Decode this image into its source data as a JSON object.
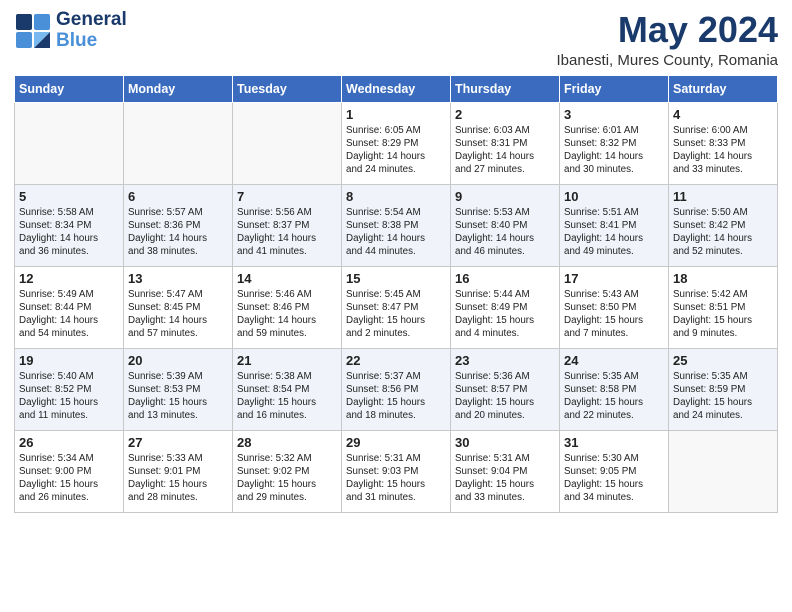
{
  "header": {
    "logo": {
      "line1": "General",
      "line2": "Blue"
    },
    "title": "May 2024",
    "subtitle": "Ibanesti, Mures County, Romania"
  },
  "days_of_week": [
    "Sunday",
    "Monday",
    "Tuesday",
    "Wednesday",
    "Thursday",
    "Friday",
    "Saturday"
  ],
  "weeks": [
    [
      {
        "day": "",
        "lines": []
      },
      {
        "day": "",
        "lines": []
      },
      {
        "day": "",
        "lines": []
      },
      {
        "day": "1",
        "lines": [
          "Sunrise: 6:05 AM",
          "Sunset: 8:29 PM",
          "Daylight: 14 hours",
          "and 24 minutes."
        ]
      },
      {
        "day": "2",
        "lines": [
          "Sunrise: 6:03 AM",
          "Sunset: 8:31 PM",
          "Daylight: 14 hours",
          "and 27 minutes."
        ]
      },
      {
        "day": "3",
        "lines": [
          "Sunrise: 6:01 AM",
          "Sunset: 8:32 PM",
          "Daylight: 14 hours",
          "and 30 minutes."
        ]
      },
      {
        "day": "4",
        "lines": [
          "Sunrise: 6:00 AM",
          "Sunset: 8:33 PM",
          "Daylight: 14 hours",
          "and 33 minutes."
        ]
      }
    ],
    [
      {
        "day": "5",
        "lines": [
          "Sunrise: 5:58 AM",
          "Sunset: 8:34 PM",
          "Daylight: 14 hours",
          "and 36 minutes."
        ]
      },
      {
        "day": "6",
        "lines": [
          "Sunrise: 5:57 AM",
          "Sunset: 8:36 PM",
          "Daylight: 14 hours",
          "and 38 minutes."
        ]
      },
      {
        "day": "7",
        "lines": [
          "Sunrise: 5:56 AM",
          "Sunset: 8:37 PM",
          "Daylight: 14 hours",
          "and 41 minutes."
        ]
      },
      {
        "day": "8",
        "lines": [
          "Sunrise: 5:54 AM",
          "Sunset: 8:38 PM",
          "Daylight: 14 hours",
          "and 44 minutes."
        ]
      },
      {
        "day": "9",
        "lines": [
          "Sunrise: 5:53 AM",
          "Sunset: 8:40 PM",
          "Daylight: 14 hours",
          "and 46 minutes."
        ]
      },
      {
        "day": "10",
        "lines": [
          "Sunrise: 5:51 AM",
          "Sunset: 8:41 PM",
          "Daylight: 14 hours",
          "and 49 minutes."
        ]
      },
      {
        "day": "11",
        "lines": [
          "Sunrise: 5:50 AM",
          "Sunset: 8:42 PM",
          "Daylight: 14 hours",
          "and 52 minutes."
        ]
      }
    ],
    [
      {
        "day": "12",
        "lines": [
          "Sunrise: 5:49 AM",
          "Sunset: 8:44 PM",
          "Daylight: 14 hours",
          "and 54 minutes."
        ]
      },
      {
        "day": "13",
        "lines": [
          "Sunrise: 5:47 AM",
          "Sunset: 8:45 PM",
          "Daylight: 14 hours",
          "and 57 minutes."
        ]
      },
      {
        "day": "14",
        "lines": [
          "Sunrise: 5:46 AM",
          "Sunset: 8:46 PM",
          "Daylight: 14 hours",
          "and 59 minutes."
        ]
      },
      {
        "day": "15",
        "lines": [
          "Sunrise: 5:45 AM",
          "Sunset: 8:47 PM",
          "Daylight: 15 hours",
          "and 2 minutes."
        ]
      },
      {
        "day": "16",
        "lines": [
          "Sunrise: 5:44 AM",
          "Sunset: 8:49 PM",
          "Daylight: 15 hours",
          "and 4 minutes."
        ]
      },
      {
        "day": "17",
        "lines": [
          "Sunrise: 5:43 AM",
          "Sunset: 8:50 PM",
          "Daylight: 15 hours",
          "and 7 minutes."
        ]
      },
      {
        "day": "18",
        "lines": [
          "Sunrise: 5:42 AM",
          "Sunset: 8:51 PM",
          "Daylight: 15 hours",
          "and 9 minutes."
        ]
      }
    ],
    [
      {
        "day": "19",
        "lines": [
          "Sunrise: 5:40 AM",
          "Sunset: 8:52 PM",
          "Daylight: 15 hours",
          "and 11 minutes."
        ]
      },
      {
        "day": "20",
        "lines": [
          "Sunrise: 5:39 AM",
          "Sunset: 8:53 PM",
          "Daylight: 15 hours",
          "and 13 minutes."
        ]
      },
      {
        "day": "21",
        "lines": [
          "Sunrise: 5:38 AM",
          "Sunset: 8:54 PM",
          "Daylight: 15 hours",
          "and 16 minutes."
        ]
      },
      {
        "day": "22",
        "lines": [
          "Sunrise: 5:37 AM",
          "Sunset: 8:56 PM",
          "Daylight: 15 hours",
          "and 18 minutes."
        ]
      },
      {
        "day": "23",
        "lines": [
          "Sunrise: 5:36 AM",
          "Sunset: 8:57 PM",
          "Daylight: 15 hours",
          "and 20 minutes."
        ]
      },
      {
        "day": "24",
        "lines": [
          "Sunrise: 5:35 AM",
          "Sunset: 8:58 PM",
          "Daylight: 15 hours",
          "and 22 minutes."
        ]
      },
      {
        "day": "25",
        "lines": [
          "Sunrise: 5:35 AM",
          "Sunset: 8:59 PM",
          "Daylight: 15 hours",
          "and 24 minutes."
        ]
      }
    ],
    [
      {
        "day": "26",
        "lines": [
          "Sunrise: 5:34 AM",
          "Sunset: 9:00 PM",
          "Daylight: 15 hours",
          "and 26 minutes."
        ]
      },
      {
        "day": "27",
        "lines": [
          "Sunrise: 5:33 AM",
          "Sunset: 9:01 PM",
          "Daylight: 15 hours",
          "and 28 minutes."
        ]
      },
      {
        "day": "28",
        "lines": [
          "Sunrise: 5:32 AM",
          "Sunset: 9:02 PM",
          "Daylight: 15 hours",
          "and 29 minutes."
        ]
      },
      {
        "day": "29",
        "lines": [
          "Sunrise: 5:31 AM",
          "Sunset: 9:03 PM",
          "Daylight: 15 hours",
          "and 31 minutes."
        ]
      },
      {
        "day": "30",
        "lines": [
          "Sunrise: 5:31 AM",
          "Sunset: 9:04 PM",
          "Daylight: 15 hours",
          "and 33 minutes."
        ]
      },
      {
        "day": "31",
        "lines": [
          "Sunrise: 5:30 AM",
          "Sunset: 9:05 PM",
          "Daylight: 15 hours",
          "and 34 minutes."
        ]
      },
      {
        "day": "",
        "lines": []
      }
    ]
  ]
}
